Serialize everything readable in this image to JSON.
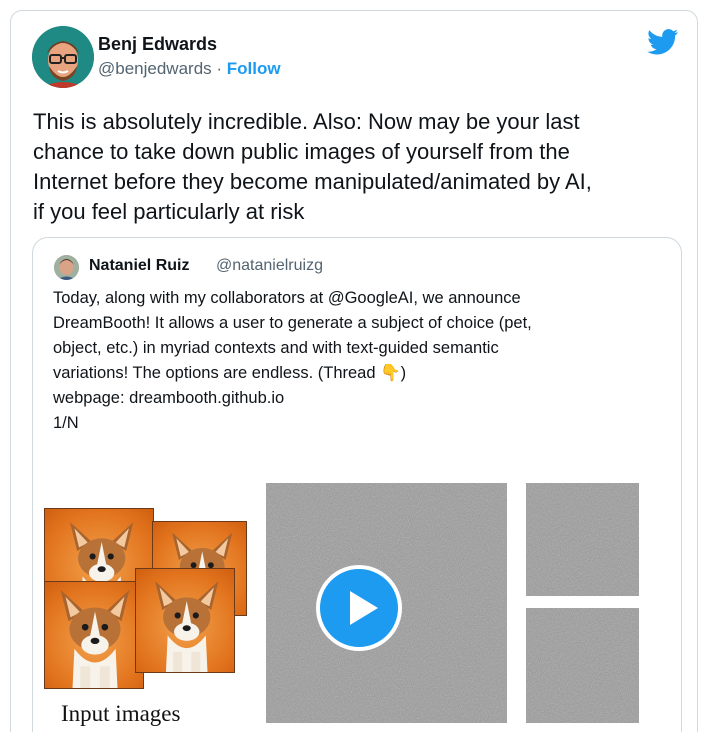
{
  "author": {
    "name": "Benj Edwards",
    "handle": "@benjedwards",
    "separator": " · ",
    "follow_label": "Follow"
  },
  "tweet": {
    "text": "This is absolutely incredible. Also: Now may be your last\nchance to take down public images of yourself from the\nInternet before they become manipulated/animated by AI,\nif you feel particularly at risk"
  },
  "quoted_tweet": {
    "name": "Nataniel Ruiz",
    "handle": "@natanielruizg",
    "text": "Today, along with my collaborators at @GoogleAI, we announce\nDreamBooth! It allows a user to generate a subject of choice (pet,\nobject, etc.) in myriad contexts and with text-guided semantic\nvariations! The options are endless. (Thread 👇)\nwebpage: dreambooth.github.io\n1/N",
    "media": {
      "input_caption": "Input images"
    }
  },
  "icons": {
    "brand": "twitter-bird-icon",
    "video": "play-icon"
  },
  "colors": {
    "accent": "#1d9bf0",
    "text_primary": "#0f1419",
    "text_secondary": "#536471",
    "border": "#cfd9de"
  }
}
